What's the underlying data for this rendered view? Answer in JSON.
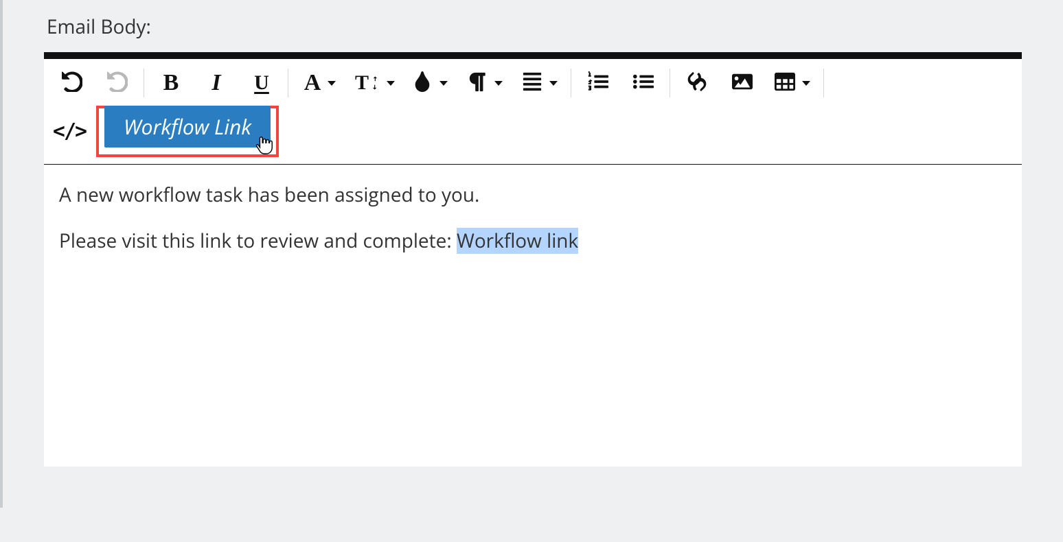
{
  "field_label": "Email Body:",
  "toolbar": {
    "workflow_link_label": "Workflow Link",
    "bold_glyph": "B",
    "italic_glyph": "I",
    "underline_glyph": "U",
    "font_family_glyph": "A",
    "font_size_glyph": "T",
    "code_glyph": "</>"
  },
  "body": {
    "line1": "A new workflow task has been assigned to you.",
    "line2_prefix": "Please visit this link to review and complete: ",
    "line2_link_text": "Workflow link"
  }
}
